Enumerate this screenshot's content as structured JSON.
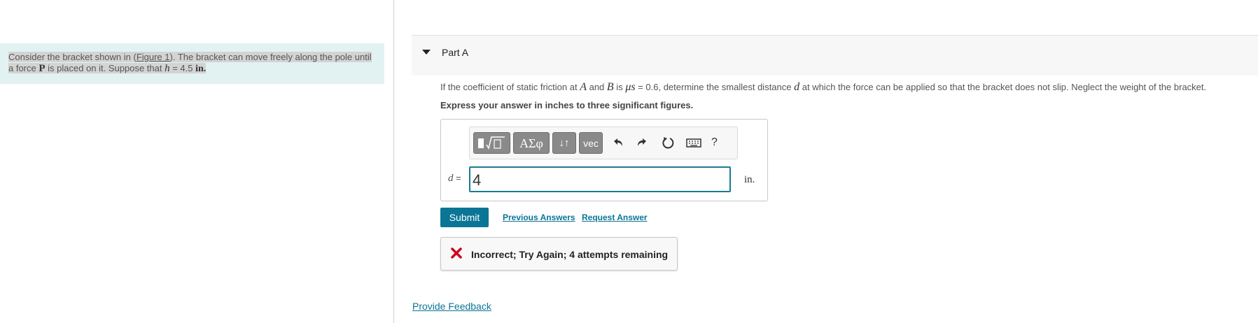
{
  "intro": {
    "t1": "Consider the bracket shown in (",
    "figure_link": "Figure 1",
    "t2": "). The bracket can move freely along the pole until",
    "t3": "a force ",
    "force_symbol": "P",
    "t4": " is placed on it. Suppose that ",
    "h_symbol": "h",
    "t5": " = 4.5 ",
    "unit": "in."
  },
  "part": {
    "title": "Part A"
  },
  "question": {
    "t1": "If the coefficient of static friction at ",
    "A": "A",
    "t2": " and ",
    "B": "B",
    "t3": " is ",
    "mu": "μs",
    "t4": " = 0.6, determine the smallest distance ",
    "d": "d",
    "t5": " at which the force can be applied so that the bracket does not slip. Neglect the weight of the bracket."
  },
  "instruction": "Express your answer in inches to three significant figures.",
  "toolbar": {
    "templates_icon": "templates-icon",
    "greek": "ΑΣφ",
    "updown": "↓↑",
    "vec": "vec",
    "help": "?"
  },
  "answer": {
    "var": "d",
    "eq": " =",
    "value": "4",
    "unit": "in."
  },
  "actions": {
    "submit": "Submit",
    "previous": "Previous Answers",
    "request": "Request Answer"
  },
  "feedback": {
    "text": "Incorrect; Try Again; 4 attempts remaining",
    "icon_color": "#d0021b"
  },
  "footer": {
    "provide_feedback": "Provide Feedback"
  },
  "colors": {
    "accent": "#0b7596",
    "intro_bg": "#e2f2f2"
  }
}
